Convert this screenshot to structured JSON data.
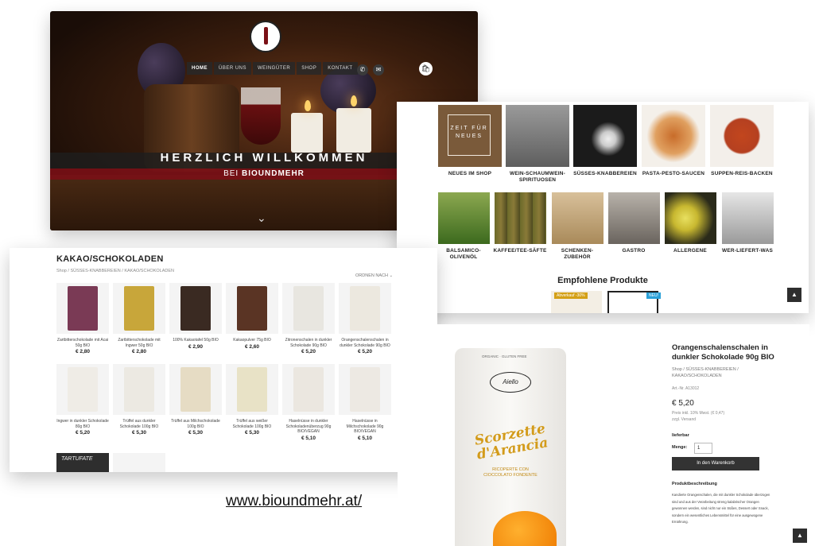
{
  "hero": {
    "nav": [
      "HOME",
      "ÜBER UNS",
      "WEINGÜTER",
      "SHOP",
      "KONTAKT"
    ],
    "welcome": "HERZLICH WILLKOMMEN",
    "sub_prefix": "BEI",
    "sub_brand": "BIOUNDMEHR"
  },
  "categories": {
    "row1": [
      {
        "label": "NEUES IM SHOP",
        "tile_text": "ZEIT FÜR NEUES",
        "color": "#7a5a3a"
      },
      {
        "label": "WEIN-SCHAUMWEIN-SPIRITUOSEN",
        "color": "#8a8a8a"
      },
      {
        "label": "SÜSSES-KNABBEREIEN",
        "color": "#1b1b1b"
      },
      {
        "label": "PASTA-PESTO-SAUCEN",
        "color": "#c86c2a"
      },
      {
        "label": "SUPPEN-REIS-BACKEN",
        "color": "#c2461e"
      }
    ],
    "row2": [
      {
        "label": "BALSAMICO-OLIVENÖL",
        "color": "#4d7a2a"
      },
      {
        "label": "KAFFEE/TEE-SÄFTE",
        "color": "#6b6a2a"
      },
      {
        "label": "SCHENKEN-ZUBEHÖR",
        "color": "#c9a97a"
      },
      {
        "label": "GASTRO",
        "color": "#8a8580"
      },
      {
        "label": "ALLERGENE",
        "color": "#c8b830"
      },
      {
        "label": "WER-LIEFERT-WAS",
        "color": "#7b7b7b"
      }
    ],
    "featured_title": "Empfohlene Produkte",
    "badge_sale": "Abverkauf -30%",
    "badge_new": "NEU!"
  },
  "shop": {
    "title": "KAKAO/SCHOKOLADEN",
    "breadcrumb": [
      "Shop",
      "SÜSSES-KNABBEREIEN",
      "KAKAO/SCHOKOLADEN"
    ],
    "sort": "ORDNEN NACH",
    "products": [
      {
        "name": "Zartbitterschokolade mit Acai 50g BIO",
        "price": "€ 2,80",
        "color": "#7a3a55"
      },
      {
        "name": "Zartbitterschokolade mit Ingwer 50g BIO",
        "price": "€ 2,80",
        "color": "#c8a63a"
      },
      {
        "name": "100% Kakaotafel 50g BIO",
        "price": "€ 2,90",
        "color": "#3a2a22"
      },
      {
        "name": "Kakaopulver 75g BIO",
        "price": "€ 2,60",
        "color": "#5a3424"
      },
      {
        "name": "Zitronenschalen in dunkler Schokolade 90g BIO",
        "price": "€ 5,20",
        "color": "#e8e6e0"
      },
      {
        "name": "Orangenschalenschalen in dunkler Schokolade 90g BIO",
        "price": "€ 5,20",
        "color": "#ece8df"
      },
      {
        "name": "Ingwer in dunkler Schokolade 80g BIO",
        "price": "€ 5,20",
        "color": "#efece6"
      },
      {
        "name": "Trüffel aus dunkler Schokolade 100g BIO",
        "price": "€ 5,30",
        "color": "#ece9e2"
      },
      {
        "name": "Trüffel aus Milchschokolade 100g BIO",
        "price": "€ 5,30",
        "color": "#e6dcc4"
      },
      {
        "name": "Trüffel aus weißer Schokolade 100g BIO",
        "price": "€ 5,30",
        "color": "#e8e2c6"
      },
      {
        "name": "Haselnüsse in dunkler Schokoladenüberzug 90g BIO/VEGAN",
        "price": "€ 5,10",
        "color": "#ebe7e0"
      },
      {
        "name": "Haselnüsse in Milchschokolade 90g BIO/VEGAN",
        "price": "€ 5,10",
        "color": "#ede9e3"
      }
    ],
    "partial_label": "TARTUFATE"
  },
  "detail": {
    "bag_top": "ORGANIC · GLUTEN FREE",
    "bag_brand": "Aiello",
    "bag_title": "Scorzette d'Arancia",
    "bag_desc": "RICOPERTE CON CIOCCOLATO FONDENTE",
    "name": "Orangenschalenschalen in dunkler Schokolade 90g BIO",
    "breadcrumb": "Shop / SÜSSES-KNABBEREIEN / KAKAO/SCHOKOLADEN",
    "sku": "Art.-Nr. A13012",
    "price": "€ 5,20",
    "tax": "Preis inkl. 10% Mwst. (€ 0,47)",
    "shipping": "zzgl. Versand",
    "availability": "lieferbar",
    "qty_label": "Menge:",
    "qty": "1",
    "cart_button": "In den Warenkorb",
    "desc_title": "Produktbeschreibung",
    "desc_text": "Kandierte Orangenschalen, die mit dunkler Schokolade überzogen sind und aus der Verarbeitung streng kalabrischer Orangen gewonnen werden, sind nicht nur ein Süßes, Dessert oder Snack, sondern ein wesentliches Lebensmittel für eine ausgewogene Ernährung."
  },
  "url": "www.bioundmehr.at/"
}
